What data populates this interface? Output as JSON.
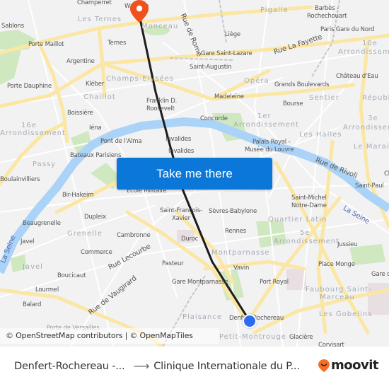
{
  "map": {
    "districts": [
      {
        "text": "Les Ternes"
      },
      {
        "text": "Monceau"
      },
      {
        "text": "Pigalle"
      },
      {
        "text": "10e"
      },
      {
        "text": "Arrondissement"
      },
      {
        "text": "Champs-Elysées"
      },
      {
        "text": "Chaillot"
      },
      {
        "text": "Opéra"
      },
      {
        "text": "Sentier"
      },
      {
        "text": "Républ"
      },
      {
        "text": "16e"
      },
      {
        "text": "Arrondissement"
      },
      {
        "text": "1er"
      },
      {
        "text": "Arrondissement"
      },
      {
        "text": "3e"
      },
      {
        "text": "Arrondissement"
      },
      {
        "text": "Les Halles"
      },
      {
        "text": "Le Marais"
      },
      {
        "text": "Passy"
      },
      {
        "text": "Grenelle"
      },
      {
        "text": "Quartier Latin"
      },
      {
        "text": "5e"
      },
      {
        "text": "Arrondissement"
      },
      {
        "text": "Montparnasse"
      },
      {
        "text": "Javel"
      },
      {
        "text": "Faubourg Saint-"
      },
      {
        "text": "Marceau"
      },
      {
        "text": "Les Gobelins"
      },
      {
        "text": "Plaisance"
      },
      {
        "text": "Petit-Montrouge"
      }
    ],
    "stations": [
      {
        "text": "Champerret"
      },
      {
        "text": "Sablons"
      },
      {
        "text": "Porte Maillot"
      },
      {
        "text": "Ternes"
      },
      {
        "text": "Argentine"
      },
      {
        "text": "Porte Dauphine"
      },
      {
        "text": "Kléber"
      },
      {
        "text": "Liège"
      },
      {
        "text": "Barbès -"
      },
      {
        "text": "Rochechouart"
      },
      {
        "text": "Paris Gare du Nord"
      },
      {
        "text": "Gare Saint-Lazare"
      },
      {
        "text": "Saint-Augustin"
      },
      {
        "text": "Château d'Eau"
      },
      {
        "text": "Grands Boulevards"
      },
      {
        "text": "Boissière"
      },
      {
        "text": "Franklin D."
      },
      {
        "text": "Roosevelt"
      },
      {
        "text": "Madeleine"
      },
      {
        "text": "Bourse"
      },
      {
        "text": "Concorde"
      },
      {
        "text": "Iéna"
      },
      {
        "text": "Pont de l'Alma"
      },
      {
        "text": "Invalides"
      },
      {
        "text": "Invalides"
      },
      {
        "text": "Palais Royal -"
      },
      {
        "text": "Musée du Louvre"
      },
      {
        "text": "Bateaux Parisiens"
      },
      {
        "text": "Boulainvilliers"
      },
      {
        "text": "Saint-Paul"
      },
      {
        "text": "Bir-Hakeim"
      },
      {
        "text": "École Militaire"
      },
      {
        "text": "Saint-Michel"
      },
      {
        "text": "Notre-Dame"
      },
      {
        "text": "Saint-François-"
      },
      {
        "text": "Xavier"
      },
      {
        "text": "Sèvres-Babylone"
      },
      {
        "text": "Beaugrenelle"
      },
      {
        "text": "Dupleix"
      },
      {
        "text": "Cambronne"
      },
      {
        "text": "Rennes"
      },
      {
        "text": "Javel"
      },
      {
        "text": "Duroc"
      },
      {
        "text": "Jussieu"
      },
      {
        "text": "Commerce"
      },
      {
        "text": "Pasteur"
      },
      {
        "text": "Vavin"
      },
      {
        "text": "Place Monge"
      },
      {
        "text": "Boucicaut"
      },
      {
        "text": "Gare Montparnasse"
      },
      {
        "text": "Port Royal"
      },
      {
        "text": "Gare d"
      },
      {
        "text": "Lourmel"
      },
      {
        "text": "Balard"
      },
      {
        "text": "Denfert-Rochereau"
      },
      {
        "text": "Glacière"
      },
      {
        "text": "Corvisart"
      },
      {
        "text": "Porte de Versailles"
      },
      {
        "text": "Wagram"
      },
      {
        "text": "Ch"
      }
    ],
    "streets": [
      {
        "text": "Rue de Rome"
      },
      {
        "text": "Rue La Fayette"
      },
      {
        "text": "Rue de Rivoli"
      },
      {
        "text": "Rue Lecourbe"
      },
      {
        "text": "Rue de Vaugirard"
      }
    ],
    "rivers": [
      {
        "text": "La Seine"
      },
      {
        "text": "La Seine"
      }
    ],
    "origin_marker": "Denfert-Rochereau",
    "destination_marker": "Clinique Internationale du Parc Monceau",
    "colors": {
      "route_line": "#1d1d1d",
      "origin_dot": "#2d6cf0",
      "destination_pin": "#f0511c",
      "water": "#aad3f7",
      "park": "#c8e6b6",
      "major_road": "#fbe8a6",
      "background": "#f2f2f3"
    }
  },
  "cta": {
    "label": "Take me there",
    "color": "#0b77d9"
  },
  "attribution": {
    "text": "© OpenStreetMap contributors | © OpenMapTiles"
  },
  "footer": {
    "origin": "Denfert-Rochereau -...",
    "arrow": "⟶",
    "destination": "Clinique Internationale du P...",
    "brand": "moovit",
    "brand_color": "#f36f21"
  }
}
